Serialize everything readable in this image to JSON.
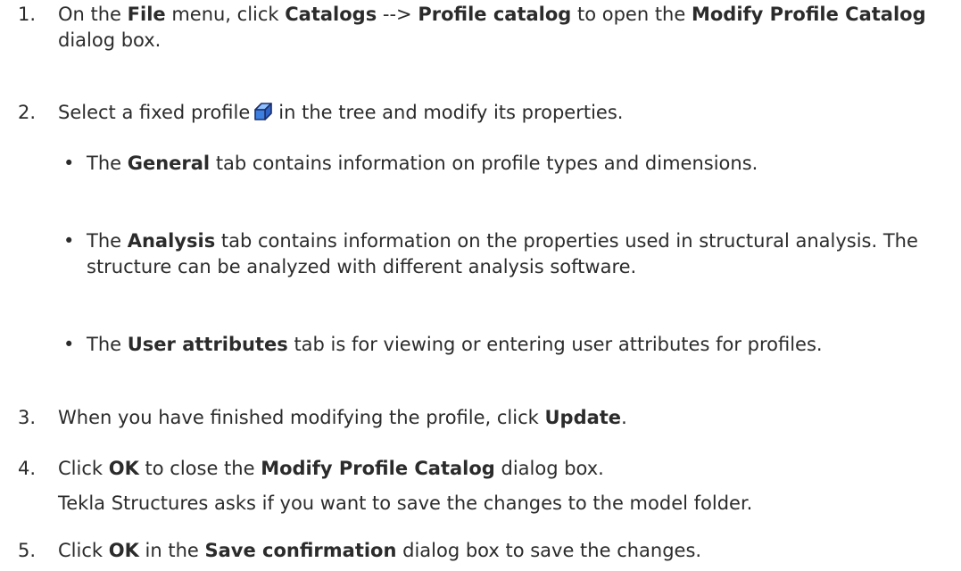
{
  "steps": [
    {
      "number": "1.",
      "parts": {
        "a": "On the ",
        "b": "File",
        "c": " menu, click ",
        "d": "Catalogs",
        "e": " --> ",
        "f": "Profile catalog",
        "g": " to open the ",
        "h": "Modify Profile Catalog",
        "i": " dialog box."
      }
    },
    {
      "number": "2.",
      "parts": {
        "a": "Select a fixed profile",
        "b": "in the tree and modify its properties."
      },
      "icon": "fixed-profile-icon",
      "bullets": [
        {
          "a": "The ",
          "b": "General",
          "c": " tab contains information on profile types and dimensions."
        },
        {
          "a": "The ",
          "b": "Analysis",
          "c": " tab contains information on the properties used in structural analysis. The structure can be analyzed with different analysis software."
        },
        {
          "a": "The ",
          "b": "User attributes",
          "c": " tab is for viewing or entering user attributes for profiles."
        }
      ]
    },
    {
      "number": "3.",
      "parts": {
        "a": "When you have finished modifying the profile, click ",
        "b": "Update",
        "c": "."
      }
    },
    {
      "number": "4.",
      "parts": {
        "a": "Click ",
        "b": "OK",
        "c": " to close the ",
        "d": "Modify Profile Catalog",
        "e": " dialog box."
      },
      "note": "Tekla Structures asks if you want to save the changes to the model folder."
    },
    {
      "number": "5.",
      "parts": {
        "a": "Click ",
        "b": "OK",
        "c": " in the ",
        "d": "Save confirmation",
        "e": " dialog box to save the changes."
      }
    }
  ],
  "colors": {
    "text": "#2b2b2b",
    "icon_fill": "#3d7fe0",
    "icon_stroke": "#1c2f6a"
  }
}
